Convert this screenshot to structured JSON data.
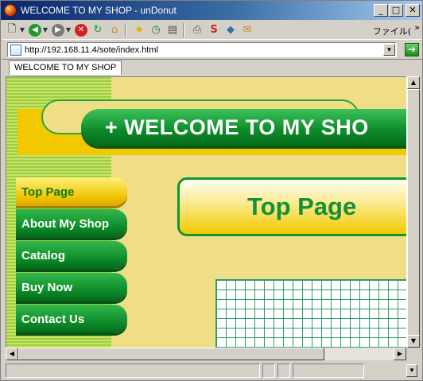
{
  "window": {
    "title": "WELCOME TO MY SHOP - unDonut"
  },
  "toolbar": {
    "file_menu_label": "ファイル(",
    "more_label": "»"
  },
  "address": {
    "url": "http://192.168.11.4/sote/index.html"
  },
  "tabs": [
    {
      "label": "WELCOME TO MY SHOP"
    }
  ],
  "page": {
    "banner_text": "+ WELCOME TO MY SHO",
    "heading": "Top Page",
    "nav": [
      {
        "label": "Top Page",
        "active": true
      },
      {
        "label": "About My Shop",
        "active": false
      },
      {
        "label": "Catalog",
        "active": false
      },
      {
        "label": "Buy Now",
        "active": false
      },
      {
        "label": "Contact Us",
        "active": false
      }
    ]
  },
  "colors": {
    "title_bar": "#0a246a",
    "page_bg": "#f0de86",
    "nav_green": "#0c8a28",
    "nav_active_yellow": "#f2c300",
    "heading_green": "#13903a"
  }
}
